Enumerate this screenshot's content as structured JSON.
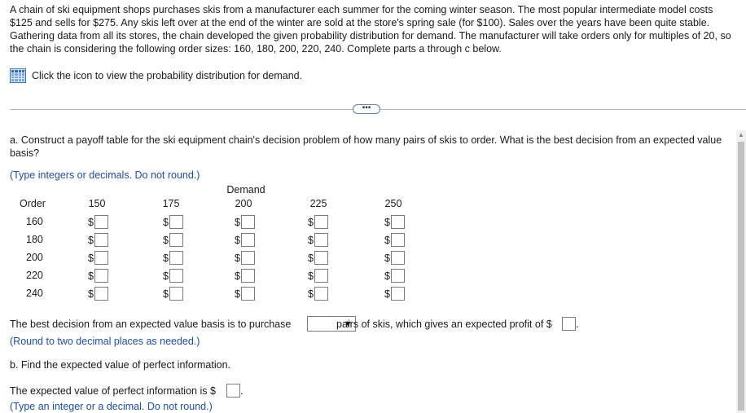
{
  "problem_text": "A chain of ski equipment shops purchases skis from a manufacturer each summer for the coming winter season. The most popular intermediate model costs $125 and sells for $275. Any skis left over at the end of the winter are sold at the store's spring sale (for $100). Sales over the years have been quite stable. Gathering data from all its stores, the chain developed the given probability distribution for demand. The manufacturer will take orders only for multiples of 20, so the chain is considering the following order sizes: 160, 180, 200, 220, 240. Complete parts a through c below.",
  "icon_link_text": "Click the icon to view the probability distribution for demand.",
  "more_button": "•••",
  "part_a": {
    "question": "a. Construct a payoff table for the ski equipment chain's decision problem of how many pairs of skis to order. What is the best decision from an expected value basis?",
    "instruction": "(Type integers or decimals. Do not round.)"
  },
  "table": {
    "demand_label": "Demand",
    "order_label": "Order",
    "demand_levels": [
      "150",
      "175",
      "200",
      "225",
      "250"
    ],
    "orders": [
      "160",
      "180",
      "200",
      "220",
      "240"
    ],
    "currency": "$"
  },
  "decision": {
    "text_before": "The best decision from an expected value basis is to purchase",
    "text_after": "pairs of skis, which gives an expected profit of $",
    "period": ".",
    "rounding_note": "(Round to two decimal places as needed.)"
  },
  "part_b": {
    "question": "b. Find the expected value of perfect information.",
    "answer_text": "The expected value of perfect information is $",
    "period": ".",
    "instruction": "(Type an integer or a decimal. Do not round.)"
  },
  "colors": {
    "link_blue": "#1f4e9d",
    "icon_blue": "#2f6fbd"
  }
}
